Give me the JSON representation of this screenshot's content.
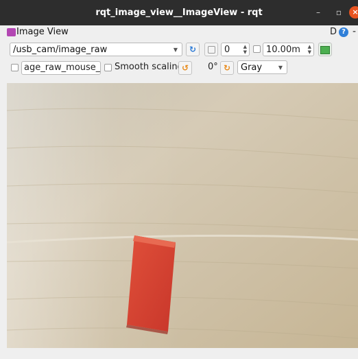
{
  "window": {
    "title": "rqt_image_view__ImageView - rqt",
    "min_glyph": "–",
    "max_glyph": "▫",
    "close_glyph": "×"
  },
  "plugin": {
    "title": "Image View",
    "d_label": "D",
    "help_glyph": "?",
    "dash_label": "-"
  },
  "toolbar": {
    "topic": "/usb_cam/image_raw",
    "frames_value": "0",
    "timeout_value": "10.00m",
    "mouse_topic_value": "age_raw_mouse_left",
    "smooth_scaling_label": "Smooth scaling",
    "smooth_scaling_checked": false,
    "rotation_label": "0°",
    "color_scheme": "Gray"
  },
  "colors": {
    "titlebar": "#2d2d2d",
    "close_button": "#e95420",
    "accent": "#2f7fd8"
  }
}
